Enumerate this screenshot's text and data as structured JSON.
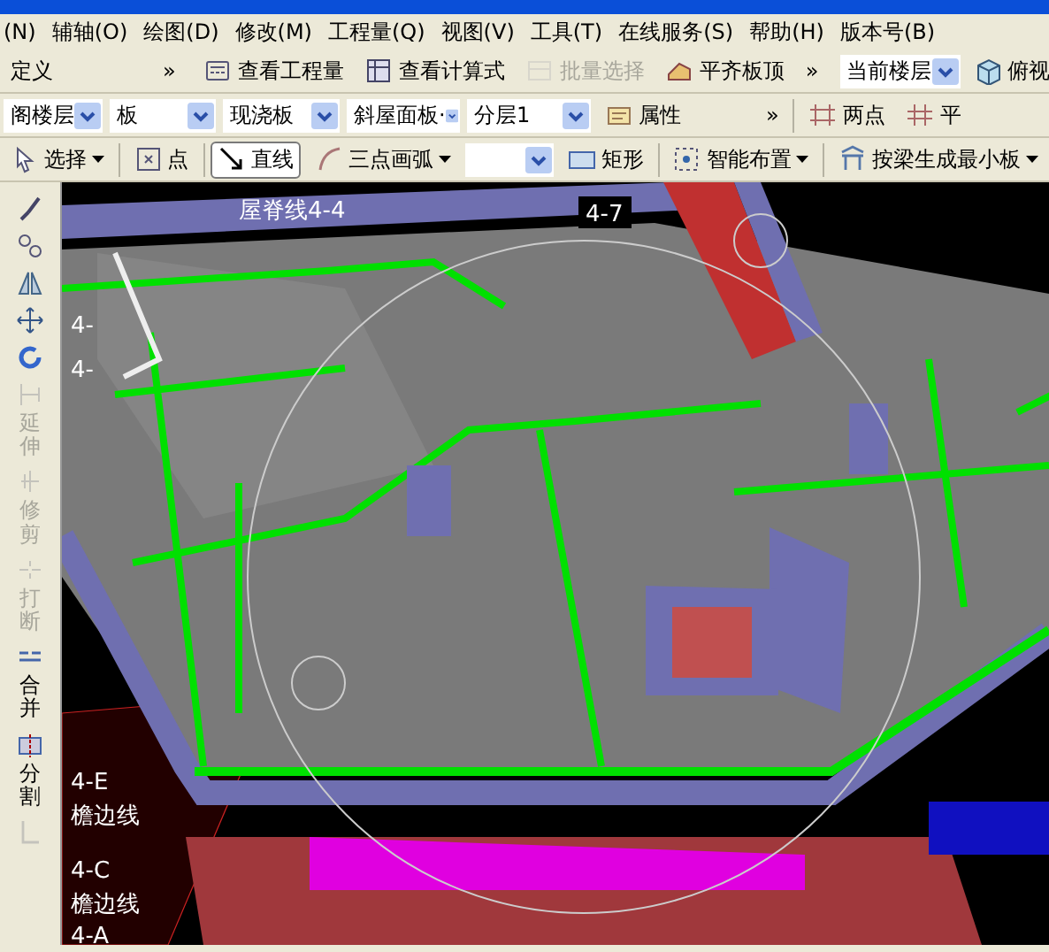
{
  "menu": [
    {
      "label": "(N)"
    },
    {
      "label": "辅轴(O)"
    },
    {
      "label": "绘图(D)"
    },
    {
      "label": "修改(M)"
    },
    {
      "label": "工程量(Q)"
    },
    {
      "label": "视图(V)"
    },
    {
      "label": "工具(T)"
    },
    {
      "label": "在线服务(S)"
    },
    {
      "label": "帮助(H)"
    },
    {
      "label": "版本号(B)"
    }
  ],
  "toolbar_1": [
    {
      "kind": "text",
      "label": "定义",
      "disabled": false
    },
    {
      "kind": "more",
      "label": "»",
      "disabled": false
    },
    {
      "kind": "calc",
      "label": "查看工程量",
      "disabled": false
    },
    {
      "kind": "formula",
      "label": "查看计算式",
      "disabled": false
    },
    {
      "kind": "batch",
      "label": "批量选择",
      "disabled": true
    },
    {
      "kind": "align",
      "label": "平齐板顶",
      "disabled": false
    },
    {
      "kind": "more",
      "label": "»",
      "disabled": false
    },
    {
      "kind": "select",
      "label": "当前楼层",
      "disabled": false
    },
    {
      "kind": "view",
      "label": "俯视",
      "disabled": false
    }
  ],
  "toolbar_2": [
    {
      "kind": "select",
      "label": "阁楼层"
    },
    {
      "kind": "select",
      "label": "板"
    },
    {
      "kind": "select",
      "label": "现浇板"
    },
    {
      "kind": "select",
      "label": "斜屋面板·"
    },
    {
      "kind": "select",
      "label": "分层1"
    },
    {
      "kind": "attr",
      "label": "属性"
    },
    {
      "kind": "more",
      "label": "»"
    },
    {
      "kind": "twopoint",
      "label": "两点"
    },
    {
      "kind": "parallel",
      "label": "平"
    }
  ],
  "toolbar_3": [
    {
      "kind": "select_tool",
      "label": "选择",
      "selected": false,
      "menu": true
    },
    {
      "kind": "point",
      "label": "点",
      "selected": false,
      "menu": false
    },
    {
      "kind": "line",
      "label": "直线",
      "selected": true,
      "menu": false
    },
    {
      "kind": "arc",
      "label": "三点画弧",
      "selected": false,
      "menu": true
    },
    {
      "kind": "combo"
    },
    {
      "kind": "rect",
      "label": "矩形",
      "selected": false,
      "menu": false
    },
    {
      "kind": "smart",
      "label": "智能布置",
      "selected": false,
      "menu": true
    },
    {
      "kind": "beam",
      "label": "按梁生成最小板",
      "selected": false,
      "menu": true
    }
  ],
  "side_tools": [
    {
      "kind": "brush",
      "disabled": false
    },
    {
      "kind": "copy",
      "disabled": false
    },
    {
      "kind": "mirror",
      "disabled": false
    },
    {
      "kind": "move",
      "disabled": false
    },
    {
      "kind": "rotate",
      "disabled": false
    },
    {
      "kind": "extend",
      "label": "延伸",
      "disabled": true
    },
    {
      "kind": "trim",
      "label": "修剪",
      "disabled": true
    },
    {
      "kind": "break",
      "label": "打断",
      "disabled": true
    },
    {
      "kind": "merge",
      "label": "合并",
      "disabled": false
    },
    {
      "kind": "split",
      "label": "分割",
      "disabled": false
    },
    {
      "kind": "misc",
      "disabled": true
    }
  ],
  "viewport": {
    "labels": [
      {
        "text": "屋脊线4-4"
      },
      {
        "text": "4-7"
      },
      {
        "text": "4-"
      },
      {
        "text": "4-"
      },
      {
        "text": "4-E"
      },
      {
        "text": "檐边线"
      },
      {
        "text": "4-C"
      },
      {
        "text": "檐边线"
      },
      {
        "text": "4-A"
      }
    ]
  }
}
